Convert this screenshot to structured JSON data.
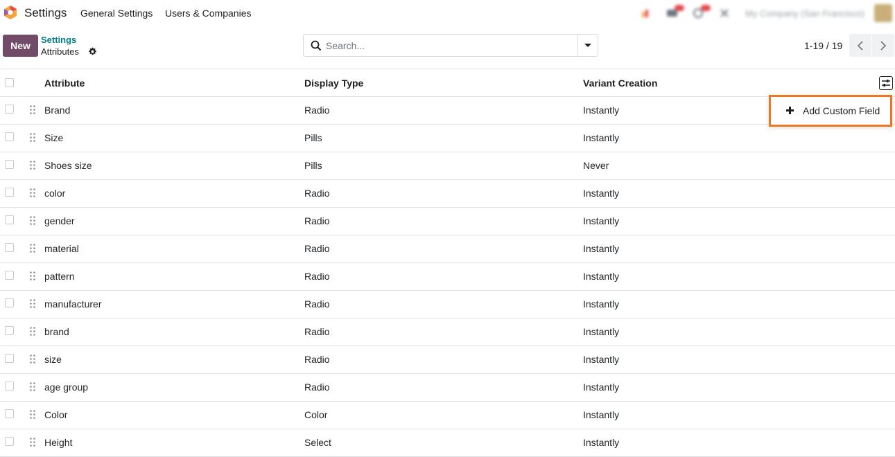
{
  "navbar": {
    "app_name": "Settings",
    "menu": [
      {
        "label": "General Settings"
      },
      {
        "label": "Users & Companies"
      }
    ],
    "company": "My Company (San Francisco)",
    "logo_icon": "odoo-settings-hexagon-icon"
  },
  "control_panel": {
    "new_label": "New",
    "breadcrumb_parent": "Settings",
    "breadcrumb_current": "Attributes",
    "search_placeholder": "Search...",
    "pager": "1-19 / 19"
  },
  "list": {
    "columns": {
      "attribute": "Attribute",
      "display_type": "Display Type",
      "variant_creation": "Variant Creation"
    },
    "rows": [
      {
        "attribute": "Brand",
        "display_type": "Radio",
        "variant_creation": "Instantly"
      },
      {
        "attribute": "Size",
        "display_type": "Pills",
        "variant_creation": "Instantly"
      },
      {
        "attribute": "Shoes size",
        "display_type": "Pills",
        "variant_creation": "Never"
      },
      {
        "attribute": "color",
        "display_type": "Radio",
        "variant_creation": "Instantly"
      },
      {
        "attribute": "gender",
        "display_type": "Radio",
        "variant_creation": "Instantly"
      },
      {
        "attribute": "material",
        "display_type": "Radio",
        "variant_creation": "Instantly"
      },
      {
        "attribute": "pattern",
        "display_type": "Radio",
        "variant_creation": "Instantly"
      },
      {
        "attribute": "manufacturer",
        "display_type": "Radio",
        "variant_creation": "Instantly"
      },
      {
        "attribute": "brand",
        "display_type": "Radio",
        "variant_creation": "Instantly"
      },
      {
        "attribute": "size",
        "display_type": "Radio",
        "variant_creation": "Instantly"
      },
      {
        "attribute": "age group",
        "display_type": "Radio",
        "variant_creation": "Instantly"
      },
      {
        "attribute": "Color",
        "display_type": "Color",
        "variant_creation": "Instantly"
      },
      {
        "attribute": "Height",
        "display_type": "Select",
        "variant_creation": "Instantly"
      }
    ]
  },
  "dropdown": {
    "add_custom_field": "Add Custom Field"
  },
  "colors": {
    "primary": "#714b67",
    "link": "#017e84",
    "highlight": "#f07522"
  }
}
